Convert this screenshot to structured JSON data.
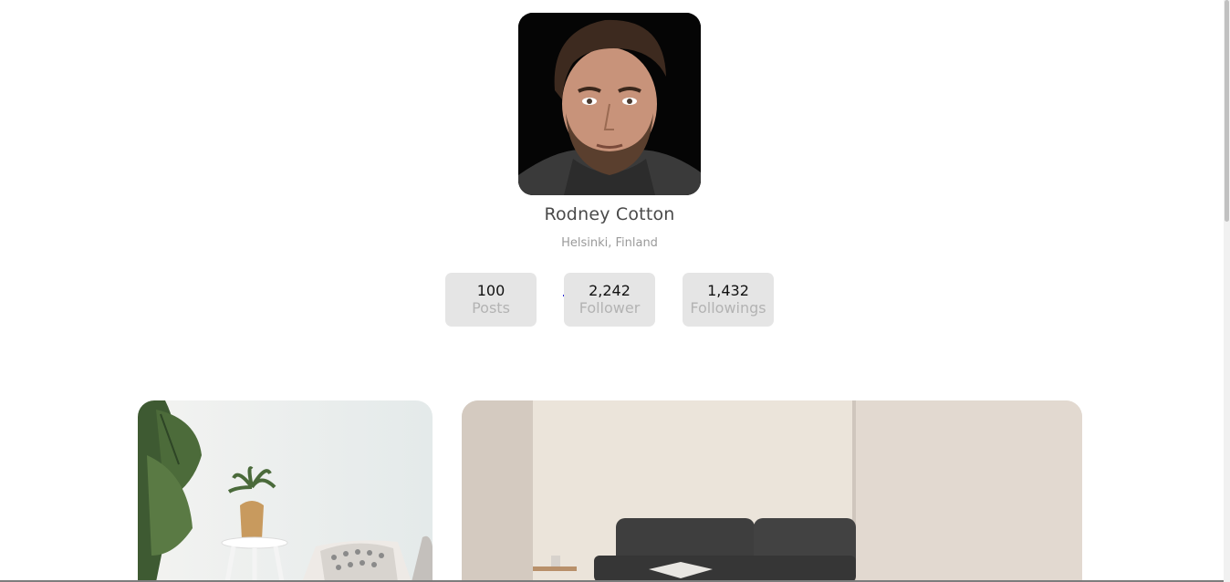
{
  "profile": {
    "name": "Rodney Cotton",
    "location": "Helsinki, Finland"
  },
  "stats": [
    {
      "value": "100",
      "label": "Posts"
    },
    {
      "value": "2,242",
      "label": "Follower"
    },
    {
      "value": "1,432",
      "label": "Followings"
    }
  ],
  "gallery": [
    {
      "subject": "white wall with plant and side table"
    },
    {
      "subject": "living room with dark sofa"
    }
  ]
}
